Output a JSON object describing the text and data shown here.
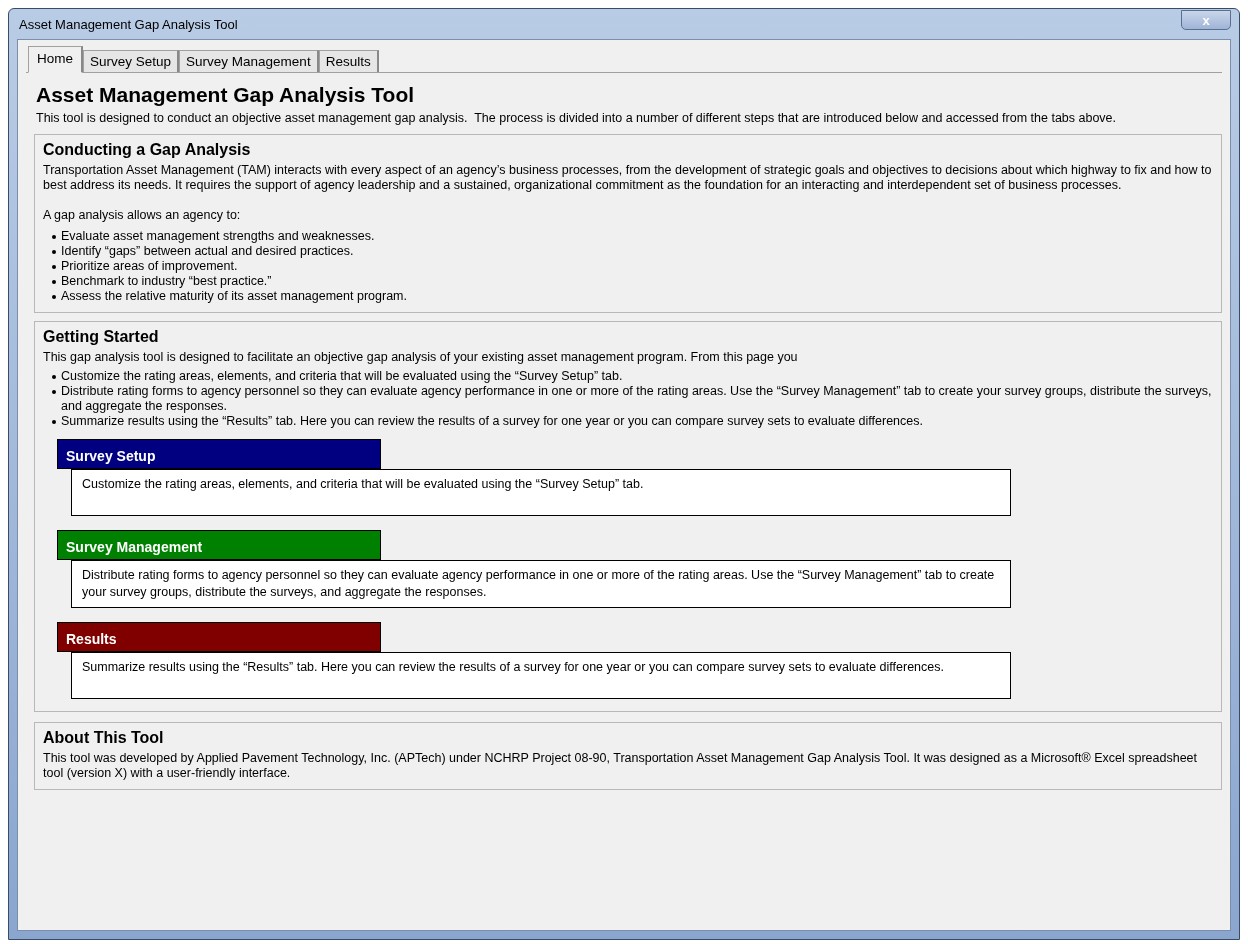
{
  "window": {
    "title": "Asset Management Gap Analysis Tool",
    "close": "x"
  },
  "tabs": [
    {
      "label": "Home",
      "selected": true
    },
    {
      "label": "Survey Setup",
      "selected": false
    },
    {
      "label": "Survey Management",
      "selected": false
    },
    {
      "label": "Results",
      "selected": false
    }
  ],
  "heading": "Asset Management Gap Analysis Tool",
  "intro": "This tool is designed to conduct an objective asset management gap analysis.  The process is divided into a number of different steps that are introduced below and accessed from the tabs above.",
  "conducting": {
    "title": "Conducting a Gap Analysis",
    "paragraph": "Transportation Asset Management (TAM) interacts with every aspect of an agency’s business processes, from the development of strategic goals and objectives to decisions about which highway to fix and how to best address its needs. It requires the support of agency leadership and a sustained, organizational commitment as the foundation for an interacting and interdependent set of business processes.",
    "lead": "A gap analysis allows an agency to:",
    "bullets": [
      "Evaluate asset management strengths and weaknesses.",
      "Identify “gaps” between actual and desired practices.",
      "Prioritize areas of improvement.",
      "Benchmark to industry “best practice.”",
      "Assess the relative maturity of its asset management program."
    ]
  },
  "getting_started": {
    "title": "Getting Started",
    "lead": "This gap analysis tool is designed to facilitate an objective gap analysis of your existing asset management program. From this page you",
    "bullets": [
      "Customize the rating areas, elements, and criteria that will be evaluated using the “Survey Setup” tab.",
      "Distribute rating forms to agency personnel so they can evaluate agency performance in one or more of the rating areas. Use the “Survey Management” tab to create your survey groups, distribute the surveys, and aggregate the responses.",
      "Summarize results using the “Results” tab. Here you can review the results of a survey for one year or you can compare survey sets to evaluate differences."
    ],
    "steps": [
      {
        "title": "Survey Setup",
        "color": "#000080",
        "text": "Customize the rating areas, elements, and criteria that will be evaluated using the “Survey Setup” tab."
      },
      {
        "title": "Survey Management",
        "color": "#008000",
        "text": "Distribute rating forms to agency personnel so they can evaluate agency performance in one or more of the rating areas. Use the “Survey Management” tab to create your survey groups, distribute the surveys, and aggregate the responses."
      },
      {
        "title": "Results",
        "color": "#800000",
        "text": "Summarize results using the “Results” tab. Here you can review the results of a survey for one year or you can compare survey sets to evaluate differences."
      }
    ]
  },
  "about": {
    "title": "About This Tool",
    "text": "This tool was developed by Applied Pavement Technology, Inc. (APTech) under NCHRP Project 08-90, Transportation Asset Management Gap Analysis Tool. It was designed as a Microsoft® Excel spreadsheet tool (version X) with a user-friendly interface."
  }
}
